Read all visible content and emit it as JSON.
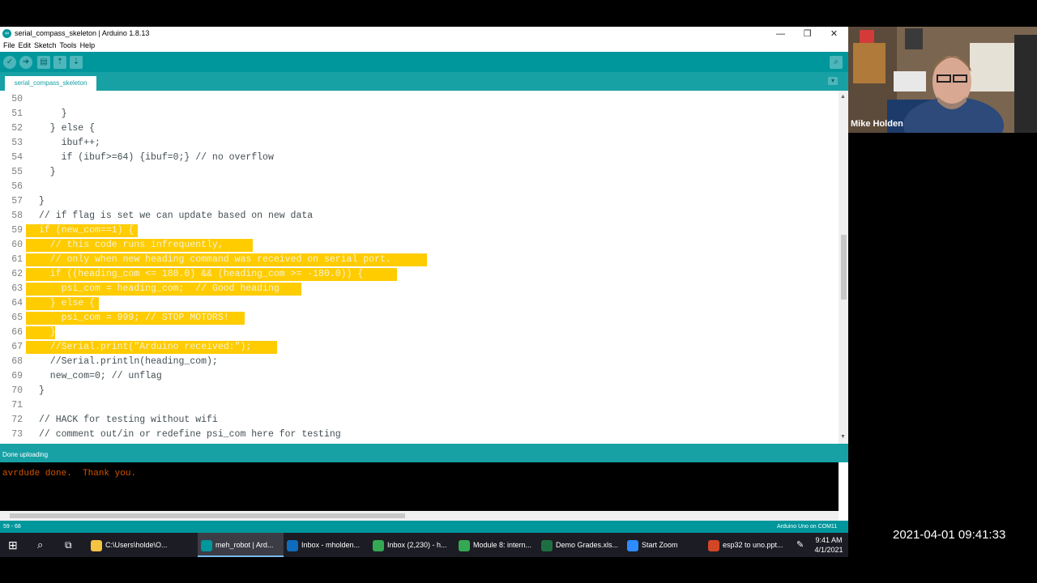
{
  "window": {
    "title": "serial_compass_skeleton | Arduino 1.8.13",
    "controls": [
      "—",
      "❐",
      "✕"
    ]
  },
  "menu": [
    "File",
    "Edit",
    "Sketch",
    "Tools",
    "Help"
  ],
  "toolbar": {
    "buttons": [
      "verify-icon",
      "upload-icon",
      "new-icon",
      "open-icon",
      "save-icon"
    ],
    "serial_monitor": "magnifier-icon"
  },
  "tab": {
    "label": "serial_compass_skeleton"
  },
  "code_lines": [
    {
      "n": "50",
      "t": "",
      "hl": 0
    },
    {
      "n": "51",
      "t": "    }",
      "hl": 0
    },
    {
      "n": "52",
      "t": "  } else {",
      "hl": 0
    },
    {
      "n": "53",
      "t": "    ibuf++;",
      "hl": 0
    },
    {
      "n": "54",
      "t": "    if (ibuf>=64) {ibuf=0;} // no overflow",
      "hl": 0
    },
    {
      "n": "55",
      "t": "  }",
      "hl": 0
    },
    {
      "n": "56",
      "t": "",
      "hl": 0
    },
    {
      "n": "57",
      "t": "}",
      "hl": 0
    },
    {
      "n": "58",
      "t": "// if flag is set we can update based on new data",
      "hl": 0
    },
    {
      "n": "59",
      "t": "if (new_com==1) {",
      "hl": 1
    },
    {
      "n": "60",
      "t": "  // this code runs infrequently,",
      "hl": 1
    },
    {
      "n": "61",
      "t": "  // only when new heading command was received on serial port.",
      "hl": 1
    },
    {
      "n": "62",
      "t": "  if ((heading_com <= 180.0) && (heading_com >= -180.0)) {",
      "hl": 1
    },
    {
      "n": "63",
      "t": "    psi_com = heading_com;  // Good heading",
      "hl": 1
    },
    {
      "n": "64",
      "t": "  } else {",
      "hl": 1
    },
    {
      "n": "65",
      "t": "    psi_com = 999; // STOP MOTORS!",
      "hl": 1
    },
    {
      "n": "66",
      "t": "  }",
      "hl": 1
    },
    {
      "n": "67",
      "t": "  //Serial.print(\"Arduino received:\");",
      "hl": 1
    },
    {
      "n": "68",
      "t": "  //Serial.println(heading_com);",
      "hl": 0
    },
    {
      "n": "69",
      "t": "  new_com=0; // unflag",
      "hl": 0
    },
    {
      "n": "70",
      "t": "}",
      "hl": 0
    },
    {
      "n": "71",
      "t": "",
      "hl": 0
    },
    {
      "n": "72",
      "t": "// HACK for testing without wifi",
      "hl": 0
    },
    {
      "n": "73",
      "t": "// comment out/in or redefine psi_com here for testing",
      "hl": 0
    }
  ],
  "status": {
    "message": "Done uploading"
  },
  "console": {
    "text": "avrdude done.  Thank you."
  },
  "footer": {
    "position": "59 - 68",
    "board": "Arduino Uno on COM11"
  },
  "taskbar": {
    "items": [
      {
        "label": "C:\\Users\\holde\\O...",
        "color": "#f5c242"
      },
      {
        "label": "meh_robot | Ard...",
        "color": "#00979c",
        "active": true
      },
      {
        "label": "Inbox - mholden...",
        "color": "#0f6cbd"
      },
      {
        "label": "Inbox (2,230) - h...",
        "color": "#34a853"
      },
      {
        "label": "Module 8: intern...",
        "color": "#34a853"
      },
      {
        "label": "Demo Grades.xls...",
        "color": "#1d6f42"
      },
      {
        "label": "Start Zoom",
        "color": "#2d8cff"
      },
      {
        "label": "esp32 to uno.ppt...",
        "color": "#d24726"
      }
    ],
    "time": "9:41 AM",
    "date": "4/1/2021"
  },
  "webcam": {
    "name": "Mike Holden"
  },
  "recording_timestamp": "2021-04-01 09:41:33"
}
